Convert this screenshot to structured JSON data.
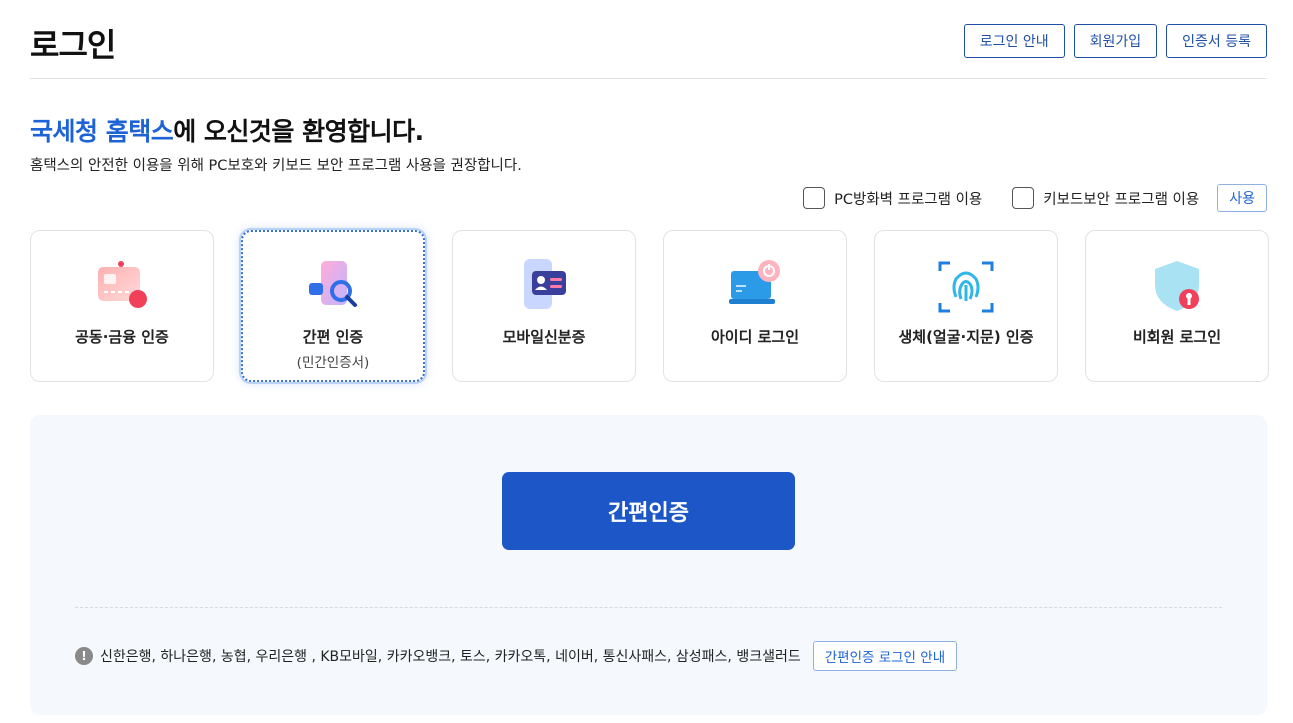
{
  "header": {
    "title": "로그인",
    "buttons": [
      "로그인 안내",
      "회원가입",
      "인증서 등록"
    ]
  },
  "welcome": {
    "highlight": "국세청 홈택스",
    "rest": "에 오신것을 환영합니다.",
    "subtitle": "홈택스의 안전한 이용을 위해 PC보호와 키보드 보안 프로그램 사용을 권장합니다."
  },
  "options": {
    "firewall_label": "PC방화벽 프로그램 이용",
    "keyboard_label": "키보드보안 프로그램 이용",
    "use_button": "사용"
  },
  "cards": [
    {
      "label": "공동·금융 인증",
      "sub": "",
      "icon": "certificate-card-icon"
    },
    {
      "label": "간편 인증",
      "sub": "(민간인증서)",
      "icon": "phone-search-icon"
    },
    {
      "label": "모바일신분증",
      "sub": "",
      "icon": "mobile-id-icon"
    },
    {
      "label": "아이디 로그인",
      "sub": "",
      "icon": "laptop-power-icon"
    },
    {
      "label": "생체(얼굴·지문) 인증",
      "sub": "",
      "icon": "fingerprint-icon"
    },
    {
      "label": "비회원 로그인",
      "sub": "",
      "icon": "shield-user-icon"
    }
  ],
  "panel": {
    "primary_button": "간편인증",
    "notice_text": "신한은행, 하나은행, 농협, 우리은행 , KB모바일, 카카오뱅크, 토스, 카카오톡, 네이버, 통신사패스, 삼성패스, 뱅크샐러드",
    "guide_button": "간편인증 로그인 안내"
  },
  "colors": {
    "accent": "#1e63d6",
    "primary_button": "#1d56c6",
    "panel_bg": "#f5f8fc"
  }
}
